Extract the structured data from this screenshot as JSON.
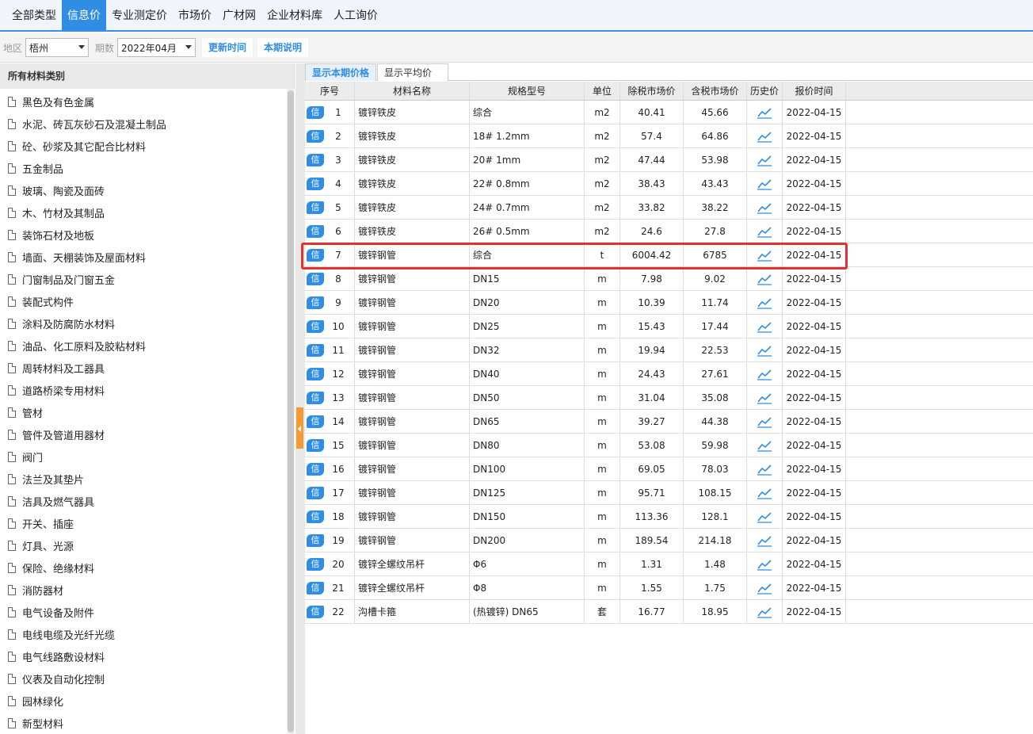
{
  "top_tabs": [
    "全部类型",
    "信息价",
    "专业测定价",
    "市场价",
    "广材网",
    "企业材料库",
    "人工询价"
  ],
  "active_tab": "信息价",
  "filter": {
    "region_label": "地区",
    "region_value": "梧州",
    "period_label": "期数",
    "period_value": "2022年04月",
    "update_time_button": "更新时间",
    "period_note_button": "本期说明"
  },
  "sidebar": {
    "header": "所有材料类别",
    "items": [
      "黑色及有色金属",
      "水泥、砖瓦灰砂石及混凝土制品",
      "砼、砂浆及其它配合比材料",
      "五金制品",
      "玻璃、陶瓷及面砖",
      "木、竹材及其制品",
      "装饰石材及地板",
      "墙面、天棚装饰及屋面材料",
      "门窗制品及门窗五金",
      "装配式构件",
      "涂料及防腐防水材料",
      "油品、化工原料及胶粘材料",
      "周转材料及工器具",
      "道路桥梁专用材料",
      "管材",
      "管件及管道用器材",
      "阀门",
      "法兰及其垫片",
      "洁具及燃气器具",
      "开关、插座",
      "灯具、光源",
      "保险、绝缘材料",
      "消防器材",
      "电气设备及附件",
      "电线电缆及光纤光缆",
      "电气线路敷设材料",
      "仪表及自动化控制",
      "园林绿化",
      "新型材料"
    ]
  },
  "sub_tabs": [
    "显示本期价格",
    "显示平均价"
  ],
  "table": {
    "badge": "信",
    "headers": [
      "序号",
      "材料名称",
      "规格型号",
      "单位",
      "除税市场价",
      "含税市场价",
      "历史价",
      "报价时间"
    ],
    "rows": [
      [
        "1",
        "镀锌铁皮",
        "综合",
        "m2",
        "40.41",
        "45.66",
        "2022-04-15"
      ],
      [
        "2",
        "镀锌铁皮",
        "18# 1.2mm",
        "m2",
        "57.4",
        "64.86",
        "2022-04-15"
      ],
      [
        "3",
        "镀锌铁皮",
        "20# 1mm",
        "m2",
        "47.44",
        "53.98",
        "2022-04-15"
      ],
      [
        "4",
        "镀锌铁皮",
        "22# 0.8mm",
        "m2",
        "38.43",
        "43.43",
        "2022-04-15"
      ],
      [
        "5",
        "镀锌铁皮",
        "24# 0.7mm",
        "m2",
        "33.82",
        "38.22",
        "2022-04-15"
      ],
      [
        "6",
        "镀锌铁皮",
        "26# 0.5mm",
        "m2",
        "24.6",
        "27.8",
        "2022-04-15"
      ],
      [
        "7",
        "镀锌钢管",
        "综合",
        "t",
        "6004.42",
        "6785",
        "2022-04-15"
      ],
      [
        "8",
        "镀锌钢管",
        "DN15",
        "m",
        "7.98",
        "9.02",
        "2022-04-15"
      ],
      [
        "9",
        "镀锌钢管",
        "DN20",
        "m",
        "10.39",
        "11.74",
        "2022-04-15"
      ],
      [
        "10",
        "镀锌钢管",
        "DN25",
        "m",
        "15.43",
        "17.44",
        "2022-04-15"
      ],
      [
        "11",
        "镀锌钢管",
        "DN32",
        "m",
        "19.94",
        "22.53",
        "2022-04-15"
      ],
      [
        "12",
        "镀锌钢管",
        "DN40",
        "m",
        "24.43",
        "27.61",
        "2022-04-15"
      ],
      [
        "13",
        "镀锌钢管",
        "DN50",
        "m",
        "31.04",
        "35.08",
        "2022-04-15"
      ],
      [
        "14",
        "镀锌钢管",
        "DN65",
        "m",
        "39.27",
        "44.38",
        "2022-04-15"
      ],
      [
        "15",
        "镀锌钢管",
        "DN80",
        "m",
        "53.08",
        "59.98",
        "2022-04-15"
      ],
      [
        "16",
        "镀锌钢管",
        "DN100",
        "m",
        "69.05",
        "78.03",
        "2022-04-15"
      ],
      [
        "17",
        "镀锌钢管",
        "DN125",
        "m",
        "95.71",
        "108.15",
        "2022-04-15"
      ],
      [
        "18",
        "镀锌钢管",
        "DN150",
        "m",
        "113.36",
        "128.1",
        "2022-04-15"
      ],
      [
        "19",
        "镀锌钢管",
        "DN200",
        "m",
        "189.54",
        "214.18",
        "2022-04-15"
      ],
      [
        "20",
        "镀锌全螺纹吊杆",
        "Φ6",
        "m",
        "1.31",
        "1.48",
        "2022-04-15"
      ],
      [
        "21",
        "镀锌全螺纹吊杆",
        "Φ8",
        "m",
        "1.55",
        "1.75",
        "2022-04-15"
      ],
      [
        "22",
        "沟槽卡箍",
        "(热镀锌) DN65",
        "套",
        "16.77",
        "18.95",
        "2022-04-15"
      ]
    ],
    "highlighted_row": "7"
  },
  "colors": {
    "accent": "#2f8de4",
    "highlight_border": "#e53030",
    "collapse_handle": "#f39c33"
  }
}
